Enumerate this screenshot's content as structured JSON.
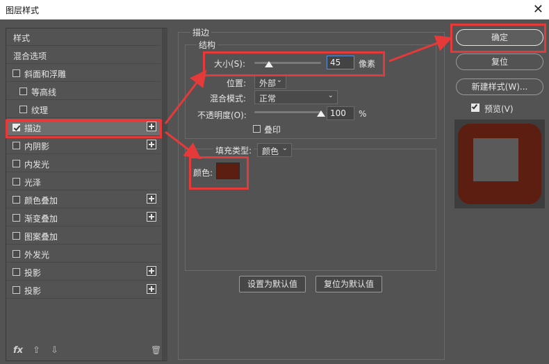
{
  "window": {
    "title": "图层样式"
  },
  "left_panel": {
    "items": [
      {
        "label": "样式",
        "checkbox": false,
        "checked": false,
        "plus": false,
        "indent": false
      },
      {
        "label": "混合选项",
        "checkbox": false,
        "checked": false,
        "plus": false,
        "indent": false
      },
      {
        "label": "斜面和浮雕",
        "checkbox": true,
        "checked": false,
        "plus": false,
        "indent": false
      },
      {
        "label": "等高线",
        "checkbox": true,
        "checked": false,
        "plus": false,
        "indent": true
      },
      {
        "label": "纹理",
        "checkbox": true,
        "checked": false,
        "plus": false,
        "indent": true
      },
      {
        "label": "描边",
        "checkbox": true,
        "checked": true,
        "plus": true,
        "indent": false,
        "active": true
      },
      {
        "label": "内阴影",
        "checkbox": true,
        "checked": false,
        "plus": true,
        "indent": false
      },
      {
        "label": "内发光",
        "checkbox": true,
        "checked": false,
        "plus": false,
        "indent": false
      },
      {
        "label": "光泽",
        "checkbox": true,
        "checked": false,
        "plus": false,
        "indent": false
      },
      {
        "label": "颜色叠加",
        "checkbox": true,
        "checked": false,
        "plus": true,
        "indent": false
      },
      {
        "label": "渐变叠加",
        "checkbox": true,
        "checked": false,
        "plus": true,
        "indent": false
      },
      {
        "label": "图案叠加",
        "checkbox": true,
        "checked": false,
        "plus": false,
        "indent": false
      },
      {
        "label": "外发光",
        "checkbox": true,
        "checked": false,
        "plus": false,
        "indent": false
      },
      {
        "label": "投影",
        "checkbox": true,
        "checked": false,
        "plus": true,
        "indent": false
      },
      {
        "label": "投影",
        "checkbox": true,
        "checked": false,
        "plus": true,
        "indent": false
      }
    ],
    "footer": {
      "fx": "fx",
      "up": "⇧",
      "down": "⇩",
      "trash": "🗑"
    }
  },
  "stroke": {
    "section_title": "描边",
    "structure_title": "结构",
    "size_label": "大小(S):",
    "size_value": "45",
    "size_unit": "像素",
    "position_label": "位置:",
    "position_value": "外部",
    "blend_label": "混合模式:",
    "blend_value": "正常",
    "opacity_label": "不透明度(O):",
    "opacity_value": "100",
    "opacity_unit": "%",
    "overprint_label": "叠印",
    "fill_type_label": "填充类型:",
    "fill_type_value": "颜色",
    "color_label": "颜色:",
    "color_hex": "#5b1e10",
    "size_slider_fraction": 0.22,
    "opacity_slider_fraction": 1.0
  },
  "buttons": {
    "set_default": "设置为默认值",
    "reset_default": "复位为默认值",
    "ok": "确定",
    "reset": "复位",
    "new_style": "新建样式(W)...",
    "preview_label": "预览(V)"
  },
  "colors": {
    "accent_red": "#e53a3a",
    "stroke_color": "#5b1e10"
  }
}
